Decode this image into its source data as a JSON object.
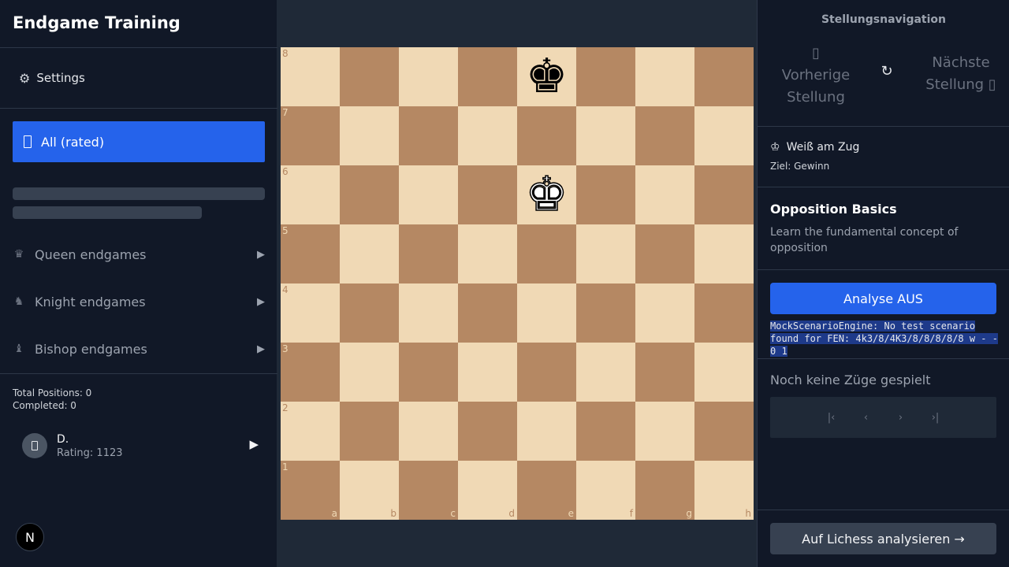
{
  "sidebar": {
    "title": "Endgame Training",
    "settings": {
      "icon": "⚙",
      "label": "Settings"
    },
    "active_category": {
      "label": "All (rated)"
    },
    "categories": [
      {
        "icon": "♛",
        "label": "Queen endgames",
        "arrow": "▶"
      },
      {
        "icon": "♞",
        "label": "Knight endgames",
        "arrow": "▶"
      },
      {
        "icon": "♝",
        "label": "Bishop endgames",
        "arrow": "▶"
      }
    ],
    "stats": {
      "total": "Total Positions: 0",
      "completed": "Completed: 0"
    },
    "user": {
      "name": "D.",
      "rating": "Rating: 1123",
      "play": "▶"
    },
    "badge": "N"
  },
  "board": {
    "ranks": [
      "8",
      "7",
      "6",
      "5",
      "4",
      "3",
      "2",
      "1"
    ],
    "files": [
      "a",
      "b",
      "c",
      "d",
      "e",
      "f",
      "g",
      "h"
    ],
    "pieces": [
      {
        "square": "e8",
        "glyph": "♚",
        "color": "black"
      },
      {
        "square": "e6",
        "glyph": "♚",
        "color": "white"
      }
    ]
  },
  "right": {
    "nav_title": "Stellungsnavigation",
    "prev_icon": "▯",
    "prev_line1": "Vorherige",
    "prev_line2": "Stellung",
    "reset_icon": "↻",
    "next_line1": "Nächste",
    "next_line2": "Stellung ▯",
    "turn_icon": "♔",
    "turn": "Weiß am Zug",
    "goal": "Ziel: Gewinn",
    "scenario_title": "Opposition Basics",
    "scenario_desc": "Learn the fundamental concept of opposition",
    "analyse_label": "Analyse AUS",
    "engine_message": "MockScenarioEngine: No test scenario found for FEN: 4k3/8/4K3/8/8/8/8/8 w - - 0 1",
    "moves_label": "Noch keine Züge gespielt",
    "move_controls": [
      "|‹",
      "‹",
      "›",
      "›|"
    ],
    "lichess_label": "Auf Lichess analysieren →"
  }
}
